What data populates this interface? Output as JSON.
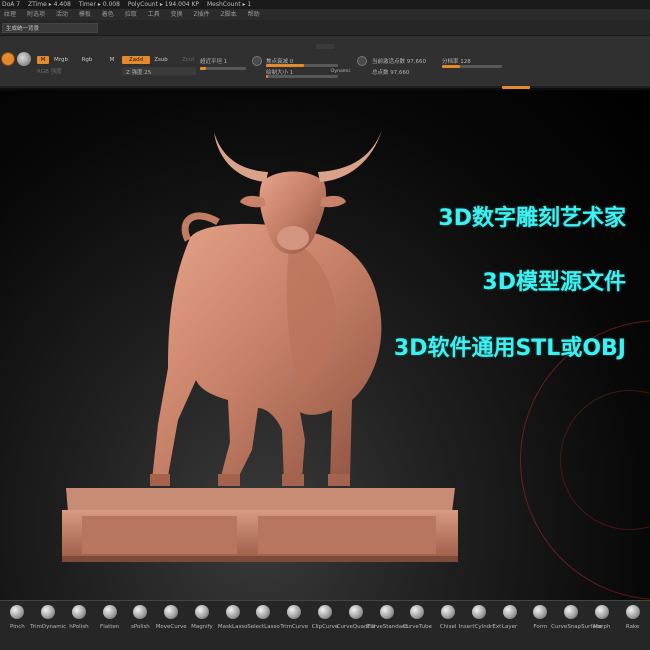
{
  "status": {
    "app": "DoA 7",
    "ztime": "ZTime ▸ 4.408",
    "timer": "Timer ▸ 0.008",
    "polycount": "PolyCount ▸ 194.004 KP",
    "meshcount": "MeshCount ▸ 1"
  },
  "menu": {
    "items": [
      "纹理",
      "附选项",
      "活动",
      "模板",
      "着色",
      "拉取",
      "工具",
      "变换",
      "Z插件",
      "Z脚本",
      "帮助"
    ]
  },
  "quicksave": "生成统一背景",
  "shelf": {
    "m_label": "M",
    "mrgb_label": "Mrgb",
    "rgb_label": "Rgb",
    "m2_label": "M",
    "rgb_intensity_label": "RGB 强度",
    "zadd_label": "Zadd",
    "zsub_label": "Zsub",
    "zintensity_label": "Z 强度",
    "zintensity_value": "25",
    "zcut_label": "Zcut",
    "smooth_label": "超近平坦",
    "smooth_value": "1",
    "focal_label": "焦点衰减",
    "focal_value": "0",
    "draw_label": "绘制大小",
    "draw_value": "1",
    "dynamic_label": "Dynamic",
    "active_points_label": "当前激活点数",
    "active_points_value": "97,660",
    "total_points_label": "总点数",
    "total_points_value": "97,660",
    "sdiv_label": "分档率",
    "sdiv_value": "128",
    "accent": "#e28a2c"
  },
  "overlay": {
    "line1": "3D数字雕刻艺术家",
    "line2": "3D模型源文件",
    "line3": "3D软件通用STL或OBJ",
    "color": "#3ff0f0"
  },
  "brushes": [
    {
      "name": "Pinch",
      "icon": "pinch-brush-icon"
    },
    {
      "name": "TrimDynamic",
      "icon": "trimdynamic-brush-icon"
    },
    {
      "name": "hPolish",
      "icon": "hpolish-brush-icon"
    },
    {
      "name": "Flatten",
      "icon": "flatten-brush-icon"
    },
    {
      "name": "sPolish",
      "icon": "spolish-brush-icon"
    },
    {
      "name": "MoveCurve",
      "icon": "movecurve-brush-icon"
    },
    {
      "name": "Magnify",
      "icon": "magnify-brush-icon"
    },
    {
      "name": "MaskLasso",
      "icon": "masklasso-brush-icon"
    },
    {
      "name": "SelectLasso",
      "icon": "selectlasso-brush-icon"
    },
    {
      "name": "TrimCurve",
      "icon": "trimcurve-brush-icon"
    },
    {
      "name": "ClipCurve",
      "icon": "clipcurve-brush-icon"
    },
    {
      "name": "CurveQuadFill",
      "icon": "curvequadfill-brush-icon"
    },
    {
      "name": "CurveStandard",
      "icon": "curvestandard-brush-icon"
    },
    {
      "name": "CurveTube",
      "icon": "curvetube-brush-icon"
    },
    {
      "name": "Chisel",
      "icon": "chisel-brush-icon"
    },
    {
      "name": "InsertCylndrExt",
      "icon": "insertcylinder-brush-icon"
    },
    {
      "name": "Layer",
      "icon": "layer-brush-icon"
    },
    {
      "name": "Form",
      "icon": "form-brush-icon"
    },
    {
      "name": "CurveSnapSurface",
      "icon": "curvesnap-brush-icon"
    },
    {
      "name": "Morph",
      "icon": "morph-brush-icon"
    },
    {
      "name": "Rake",
      "icon": "rake-brush-icon"
    }
  ]
}
